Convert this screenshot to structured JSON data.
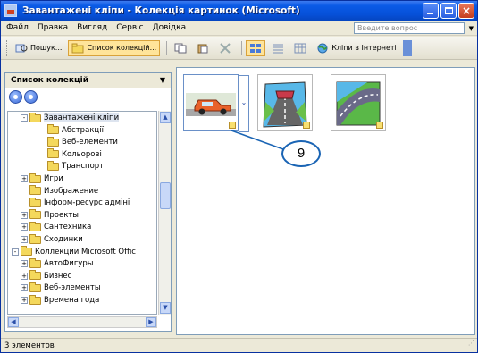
{
  "window": {
    "title": "Завантажені кліпи - Колекція картинок (Microsoft)"
  },
  "menubar": {
    "items": [
      "Файл",
      "Правка",
      "Вигляд",
      "Сервіс",
      "Довідка"
    ],
    "help_placeholder": "Введите вопрос"
  },
  "toolbar": {
    "search_label": "Пошук...",
    "collections_label": "Список колекцій...",
    "clips_online_label": "Кліпи в Інтернеті"
  },
  "left_pane": {
    "title": "Список колекцій",
    "tree": [
      {
        "label": "Завантажені кліпи",
        "level": 1,
        "expand": "-",
        "selected": true
      },
      {
        "label": "Абстракції",
        "level": 2,
        "expand": ""
      },
      {
        "label": "Веб-елементи",
        "level": 2,
        "expand": ""
      },
      {
        "label": "Кольорові",
        "level": 2,
        "expand": ""
      },
      {
        "label": "Транспорт",
        "level": 2,
        "expand": ""
      },
      {
        "label": "Игри",
        "level": 1,
        "expand": "+"
      },
      {
        "label": "Изображение",
        "level": 1,
        "expand": ""
      },
      {
        "label": "Інформ-ресурс адміні",
        "level": 1,
        "expand": ""
      },
      {
        "label": "Проекты",
        "level": 1,
        "expand": "+"
      },
      {
        "label": "Сантехника",
        "level": 1,
        "expand": "+"
      },
      {
        "label": "Сходинки",
        "level": 1,
        "expand": "+"
      },
      {
        "label": "Коллекции Microsoft Offic",
        "level": 0,
        "expand": "-"
      },
      {
        "label": "АвтоФигуры",
        "level": 1,
        "expand": "+"
      },
      {
        "label": "Бизнес",
        "level": 1,
        "expand": "+"
      },
      {
        "label": "Веб-элементы",
        "level": 1,
        "expand": "+"
      },
      {
        "label": "Времена года",
        "level": 1,
        "expand": "+"
      }
    ]
  },
  "main_pane": {
    "clips": [
      {
        "name": "car-clip",
        "selected": true
      },
      {
        "name": "road-car-clip",
        "selected": false
      },
      {
        "name": "road-clip",
        "selected": false
      }
    ],
    "callout_number": "9"
  },
  "statusbar": {
    "text": "3 элементов"
  },
  "colors": {
    "title_blue": "#0650d8",
    "callout_border": "#1a64b4"
  }
}
